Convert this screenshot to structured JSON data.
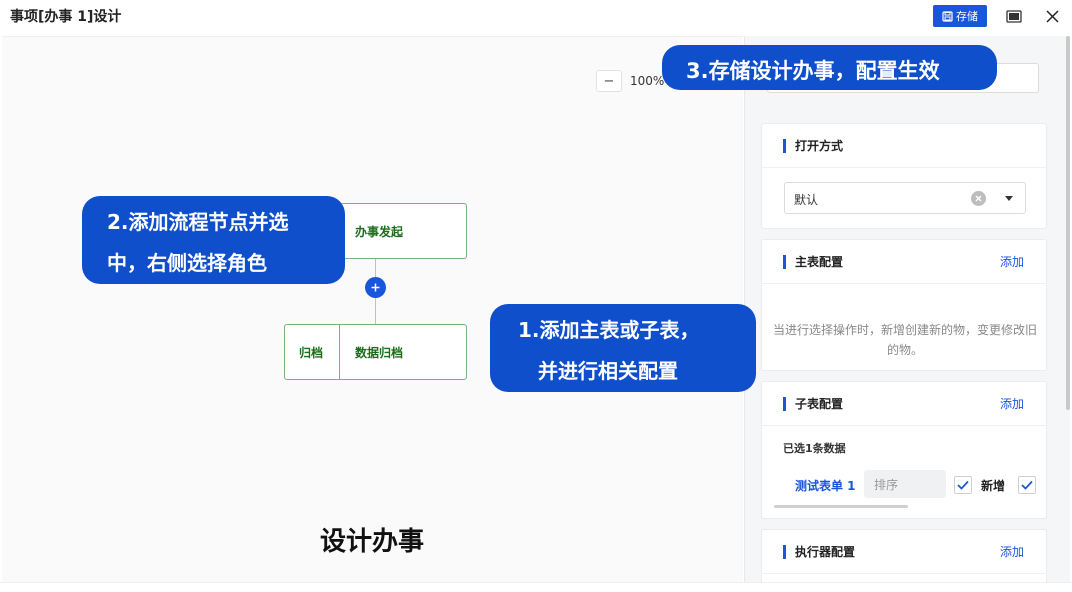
{
  "header": {
    "title": "事项[办事 1]设计",
    "save_label": "存储"
  },
  "zoom": {
    "value": "100%",
    "minus": "−"
  },
  "flow": {
    "nodes": {
      "start": "办事发起",
      "archive_label": "归档",
      "archive_title": "数据归档"
    }
  },
  "canvas_caption": "设计办事",
  "callouts": {
    "c1_line1": "1.添加主表或子表，",
    "c1_line2": "并进行相关配置",
    "c2_line1": "2.添加流程节点并选",
    "c2_line2": "中，右侧选择角色",
    "c3": "3.存储设计办事，配置生效"
  },
  "panel": {
    "open_mode": {
      "title": "打开方式",
      "value": "默认"
    },
    "main_table": {
      "title": "主表配置",
      "add": "添加",
      "hint_line1": "当进行选择操作时，新增创建新的物，变更修改旧",
      "hint_line2": "的物。"
    },
    "sub_table": {
      "title": "子表配置",
      "add": "添加",
      "selected": "已选1条数据",
      "row": {
        "name": "测试表单 1",
        "sort_placeholder": "排序",
        "add_label": "新增"
      }
    },
    "executor": {
      "title": "执行器配置",
      "add": "添加"
    }
  },
  "colors": {
    "accent": "#1a56db",
    "callout": "#0f4fcc",
    "node_border": "#7cb07c",
    "node_text": "#1d6b1d"
  }
}
